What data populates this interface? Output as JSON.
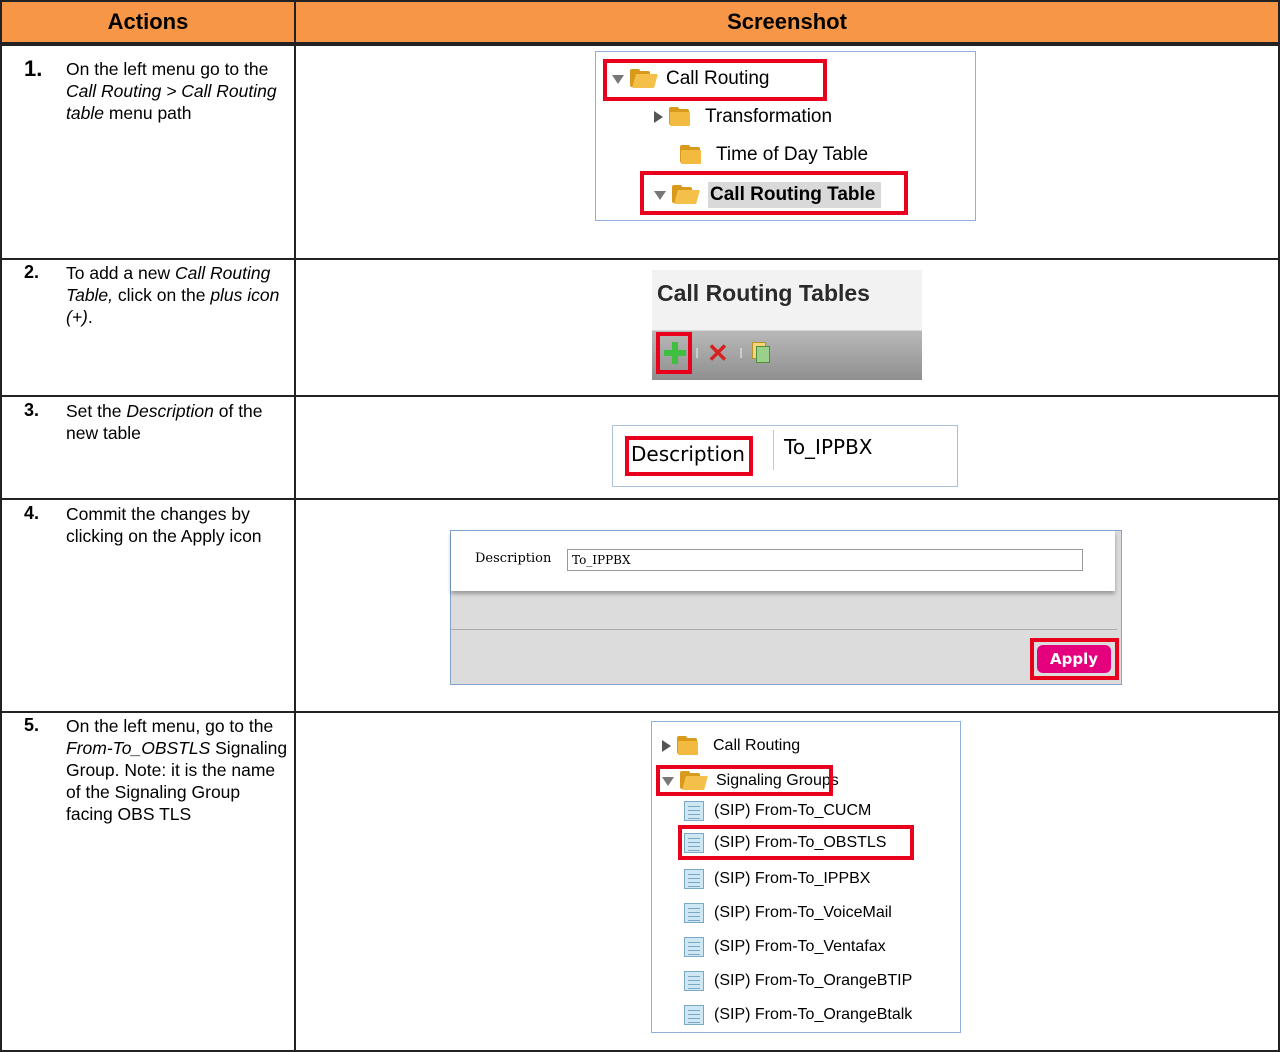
{
  "header": {
    "actions": "Actions",
    "screenshot": "Screenshot"
  },
  "steps": [
    {
      "num": "1.",
      "parts": [
        "On the left menu go to the ",
        "Call Routing > Call Routing table",
        " menu path"
      ]
    },
    {
      "num": "2.",
      "parts": [
        "To add a new ",
        "Call Routing Table,",
        " click on the ",
        "plus icon (+)",
        "."
      ]
    },
    {
      "num": "3.",
      "parts": [
        "Set the ",
        "Description",
        " of the new table"
      ]
    },
    {
      "num": "4.",
      "text": "Commit the changes by clicking on the Apply icon"
    },
    {
      "num": "5.",
      "parts": [
        "On the left menu, go to the ",
        "From-To_OBSTLS",
        " Signaling Group. Note: it is the name of the Signaling Group facing OBS TLS"
      ]
    }
  ],
  "shot1": {
    "items": [
      "Call Routing",
      "Transformation",
      "Time of Day Table",
      "Call Routing Table"
    ]
  },
  "shot2": {
    "title": "Call Routing Tables"
  },
  "shot3": {
    "label": "Description",
    "value": "To_IPPBX"
  },
  "shot4": {
    "label": "Description",
    "value": "To_IPPBX",
    "button": "Apply"
  },
  "shot5": {
    "items": [
      "Call Routing",
      "Signaling Groups",
      "(SIP) From-To_CUCM",
      "(SIP) From-To_OBSTLS",
      "(SIP) From-To_IPPBX",
      "(SIP) From-To_VoiceMail",
      "(SIP) From-To_Ventafax",
      "(SIP) From-To_OrangeBTIP",
      "(SIP) From-To_OrangeBtalk"
    ]
  },
  "colors": {
    "header_bg": "#f79646",
    "highlight": "#e8001c",
    "apply_button": "#e5007e"
  }
}
